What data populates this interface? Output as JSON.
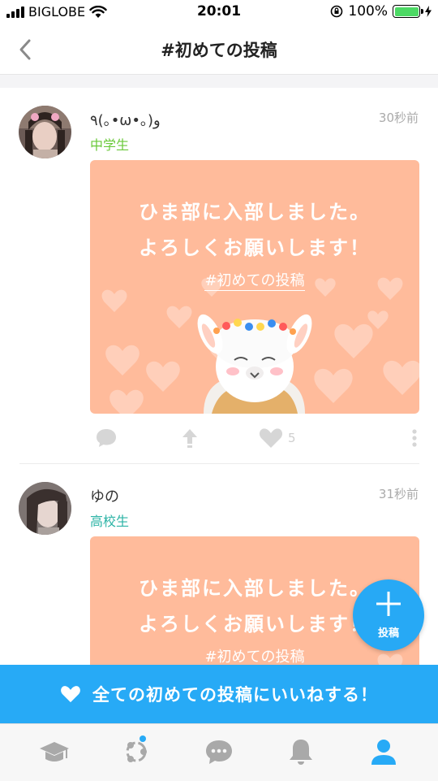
{
  "status_bar": {
    "carrier": "BIGLOBE",
    "time": "20:01",
    "battery": "100%",
    "battery_level": 1.0
  },
  "nav": {
    "title": "#初めての投稿",
    "back_icon": "chevron-left-icon"
  },
  "posts": [
    {
      "user_name": "٩(｡•ω•｡)و",
      "grade": "中学生",
      "grade_color": "#6ac93a",
      "time": "30秒前",
      "card": {
        "line1": "ひま部に入部しました。",
        "line2": "よろしくお願いします！",
        "tag": "#初めての投稿"
      },
      "likes": "5"
    },
    {
      "user_name": "ゆの",
      "grade": "高校生",
      "grade_color": "#2bb3a5",
      "time": "31秒前",
      "card": {
        "line1": "ひま部に入部しました。",
        "line2": "よろしくお願いします！",
        "tag": "#初めての投稿"
      }
    }
  ],
  "fab": {
    "label": "投稿",
    "icon": "plus-icon"
  },
  "banner": {
    "text": "全ての初めての投稿にいいねする！",
    "icon": "heart-icon"
  },
  "tabs": [
    {
      "icon": "graduation-cap-icon"
    },
    {
      "icon": "network-icon",
      "badge": true
    },
    {
      "icon": "chat-bubble-icon"
    },
    {
      "icon": "bell-icon"
    },
    {
      "icon": "person-icon",
      "active": true
    }
  ],
  "colors": {
    "accent": "#27aaf6",
    "card_bg": "#ffbb9b",
    "inactive_icon": "#a9a9a9"
  }
}
